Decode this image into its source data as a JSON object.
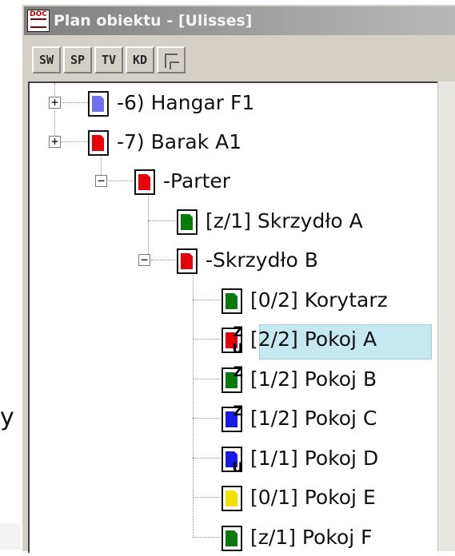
{
  "window": {
    "title": "Plan obiektu - [Ulisses]",
    "app_icon_text": "DOC"
  },
  "background": {
    "partial_text": "y"
  },
  "toolbar": {
    "buttons": [
      {
        "label": "SW"
      },
      {
        "label": "SP"
      },
      {
        "label": "TV"
      },
      {
        "label": "KD"
      }
    ]
  },
  "colors": {
    "red": "#e8000a",
    "green": "#0a7a0a",
    "blue": "#1a1ae6",
    "light_blue": "#7070f0",
    "yellow": "#f2e000",
    "selection": "#c6e8f1"
  },
  "tree": {
    "nodes": [
      {
        "label": "-6) Hangar F1",
        "icon_color": "light-blue",
        "expander": "+"
      },
      {
        "label": "-7) Barak A1",
        "icon_color": "red",
        "expander": "+"
      },
      {
        "label": "-Parter",
        "icon_color": "red",
        "expander": "−"
      },
      {
        "label": "[z/1] Skrzydło A",
        "icon_color": "green"
      },
      {
        "label": "-Skrzydło B",
        "icon_color": "red",
        "expander": "−"
      },
      {
        "label": "[0/2] Korytarz",
        "icon_color": "green"
      },
      {
        "label": "[2/2] Pokoj A",
        "icon_color": "red",
        "badges": [
          "Z",
          "U"
        ],
        "selected": true
      },
      {
        "label": "[1/2] Pokoj B",
        "icon_color": "green",
        "badges": [
          "Z"
        ]
      },
      {
        "label": "[1/2] Pokoj C",
        "icon_color": "blue",
        "badges": [
          "Z"
        ]
      },
      {
        "label": "[1/1] Pokoj D",
        "icon_color": "blue",
        "badges": [
          "U"
        ]
      },
      {
        "label": "[0/1] Pokoj E",
        "icon_color": "yellow"
      },
      {
        "label": "[z/1] Pokoj F",
        "icon_color": "green"
      }
    ]
  }
}
